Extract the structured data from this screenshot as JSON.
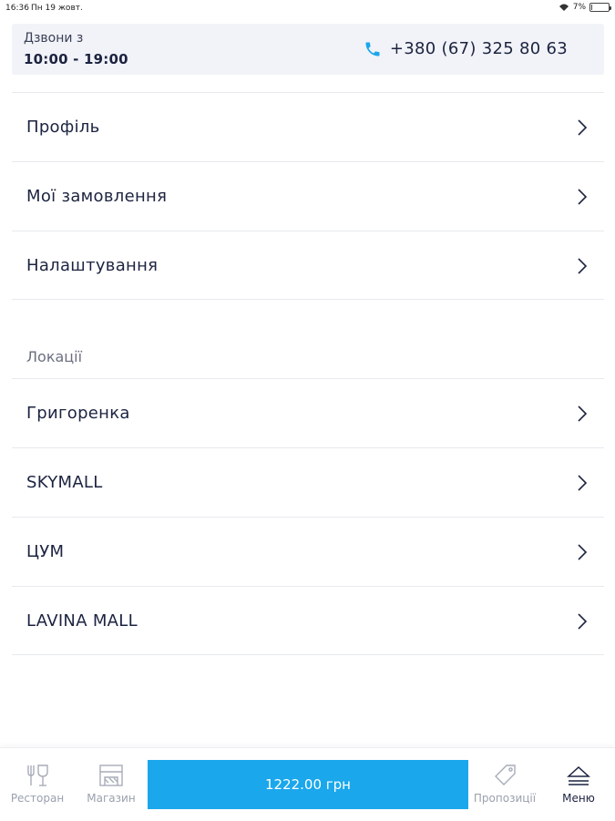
{
  "status": {
    "time": "16:36",
    "date": "Пн 19 жовт.",
    "battery": "7%",
    "battery_level": 0.07
  },
  "call": {
    "label": "Дзвони з",
    "hours": "10:00 - 19:00",
    "phone": "+380 (67) 325 80 63"
  },
  "menu": [
    {
      "label": "Профіль"
    },
    {
      "label": "Мої замовлення"
    },
    {
      "label": "Налаштування"
    }
  ],
  "locations_title": "Локації",
  "locations": [
    {
      "label": "Григоренка"
    },
    {
      "label": "SKYMALL"
    },
    {
      "label": "ЦУМ"
    },
    {
      "label": "LAVINA MALL"
    }
  ],
  "tabs": {
    "restaurant": "Ресторан",
    "shop": "Магазин",
    "cart_total": "1222.00 грн",
    "offers": "Пропозиції",
    "menu": "Меню"
  },
  "colors": {
    "accent": "#1aa7ec",
    "text": "#1c2340",
    "muted": "#9aa0ad"
  },
  "icons": [
    "phone-icon",
    "chevron-right-icon",
    "wine-glass-icon",
    "store-icon",
    "tag-icon",
    "eject-menu-icon",
    "wifi-icon",
    "battery-icon"
  ]
}
